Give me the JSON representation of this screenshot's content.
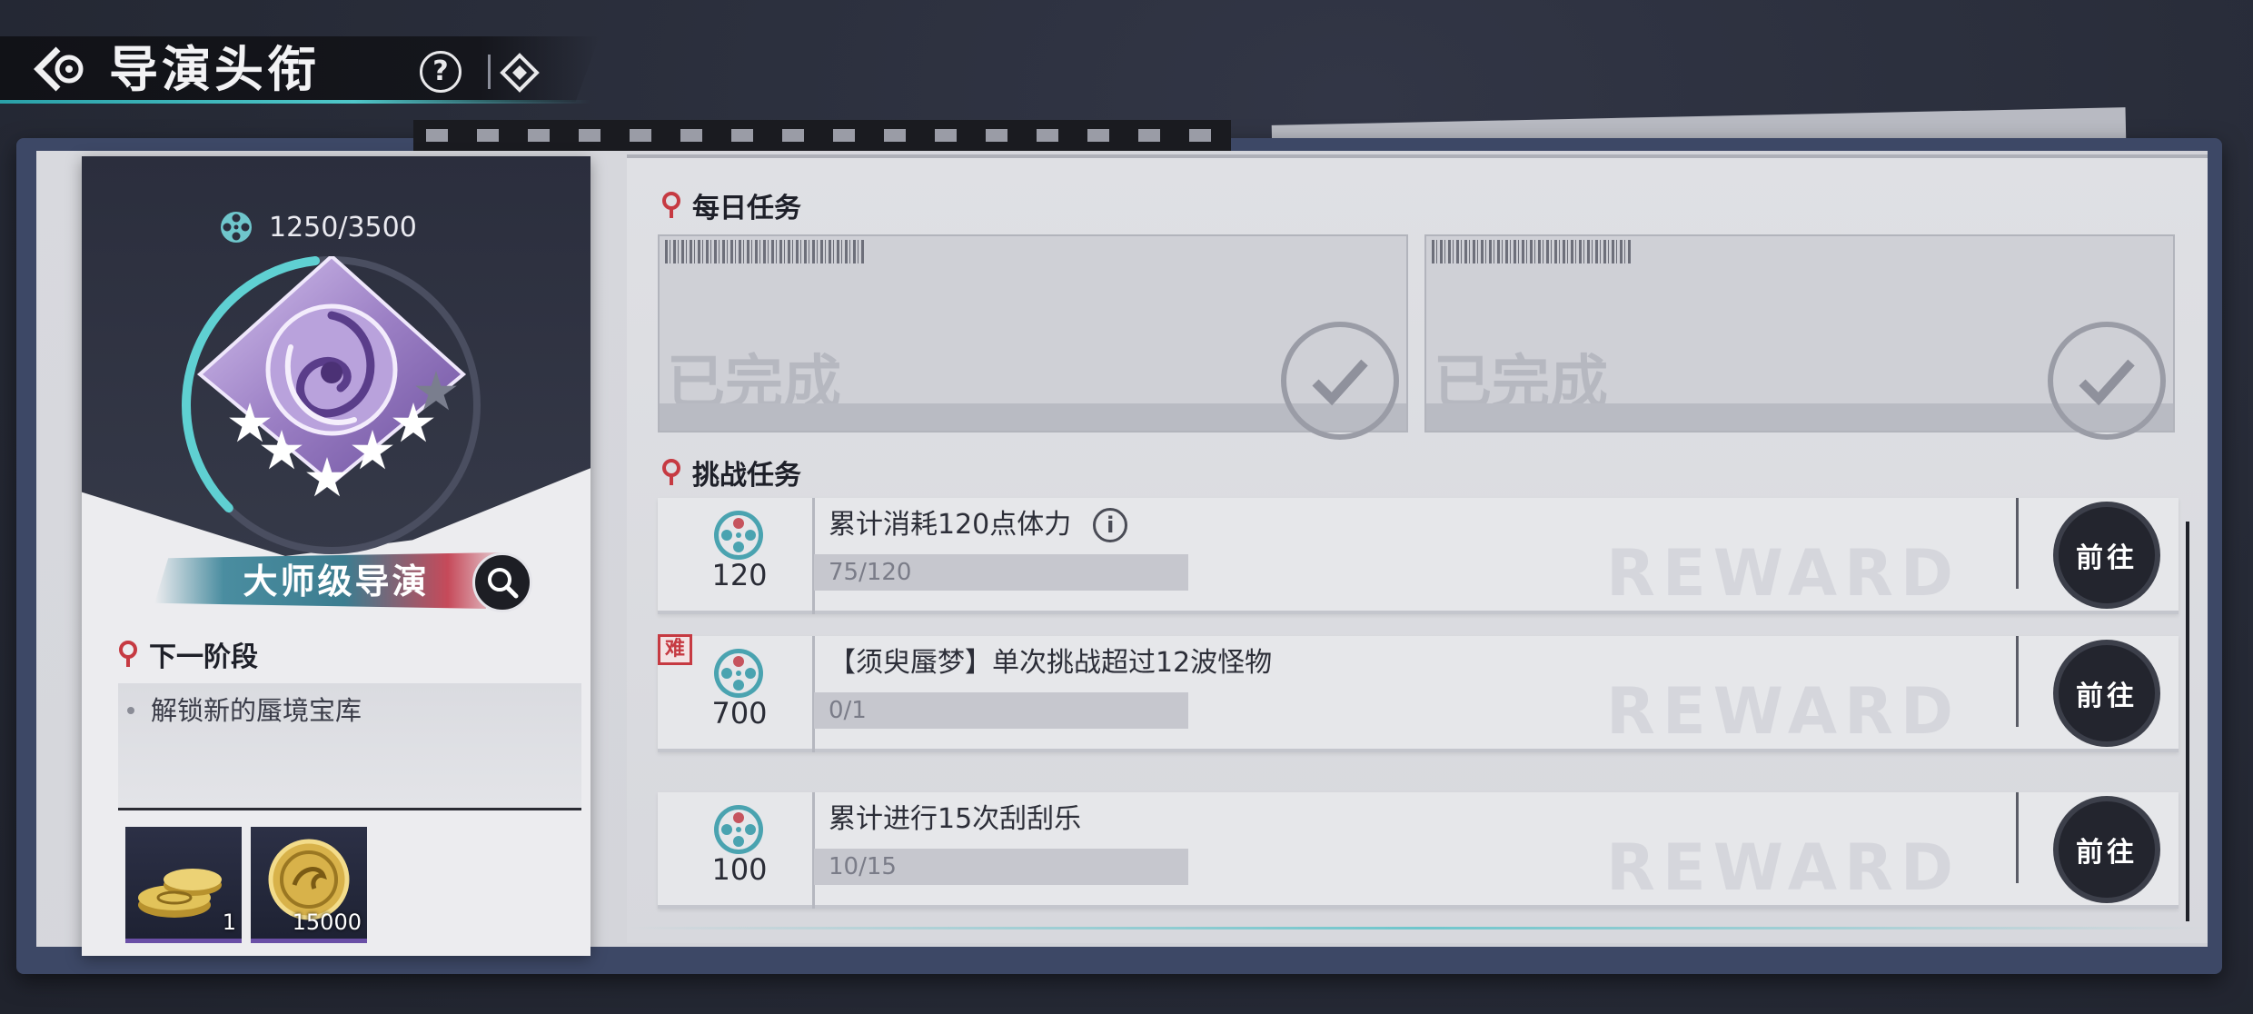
{
  "header": {
    "title": "导演头衔",
    "help_label": "?"
  },
  "rank": {
    "exp_current": 1250,
    "exp_max": 3500,
    "exp_text": "1250/3500",
    "name": "大师级导演",
    "stars_filled": 5,
    "stars_total": 6
  },
  "next_stage": {
    "heading": "下一阶段",
    "items": [
      "解锁新的蜃境宝库"
    ],
    "rewards": [
      {
        "icon": "coin-stack-icon",
        "count": "1"
      },
      {
        "icon": "gold-coin-icon",
        "count": "15000"
      }
    ]
  },
  "daily": {
    "heading": "每日任务",
    "cards": [
      {
        "status": "已完成"
      },
      {
        "status": "已完成"
      }
    ]
  },
  "challenge": {
    "heading": "挑战任务",
    "tasks": [
      {
        "reward": "120",
        "title": "累计消耗120点体力",
        "progress": "75/120",
        "progress_fraction": 0.625,
        "button": "前往",
        "hard": false,
        "has_info": true
      },
      {
        "reward": "700",
        "title": "【须臾蜃梦】单次挑战超过12波怪物",
        "progress": "0/1",
        "progress_fraction": 0.0,
        "button": "前往",
        "hard": true,
        "hard_label": "难",
        "has_info": false
      },
      {
        "reward": "100",
        "title": "累计进行15次刮刮乐",
        "progress": "10/15",
        "progress_fraction": 0.667,
        "button": "前往",
        "hard": false,
        "has_info": false
      }
    ]
  },
  "colors": {
    "accent_teal": "#4fc7c9",
    "accent_red": "#c63a42",
    "emblem_purple": "#9b7fc4",
    "dark_bg": "#262a36"
  }
}
